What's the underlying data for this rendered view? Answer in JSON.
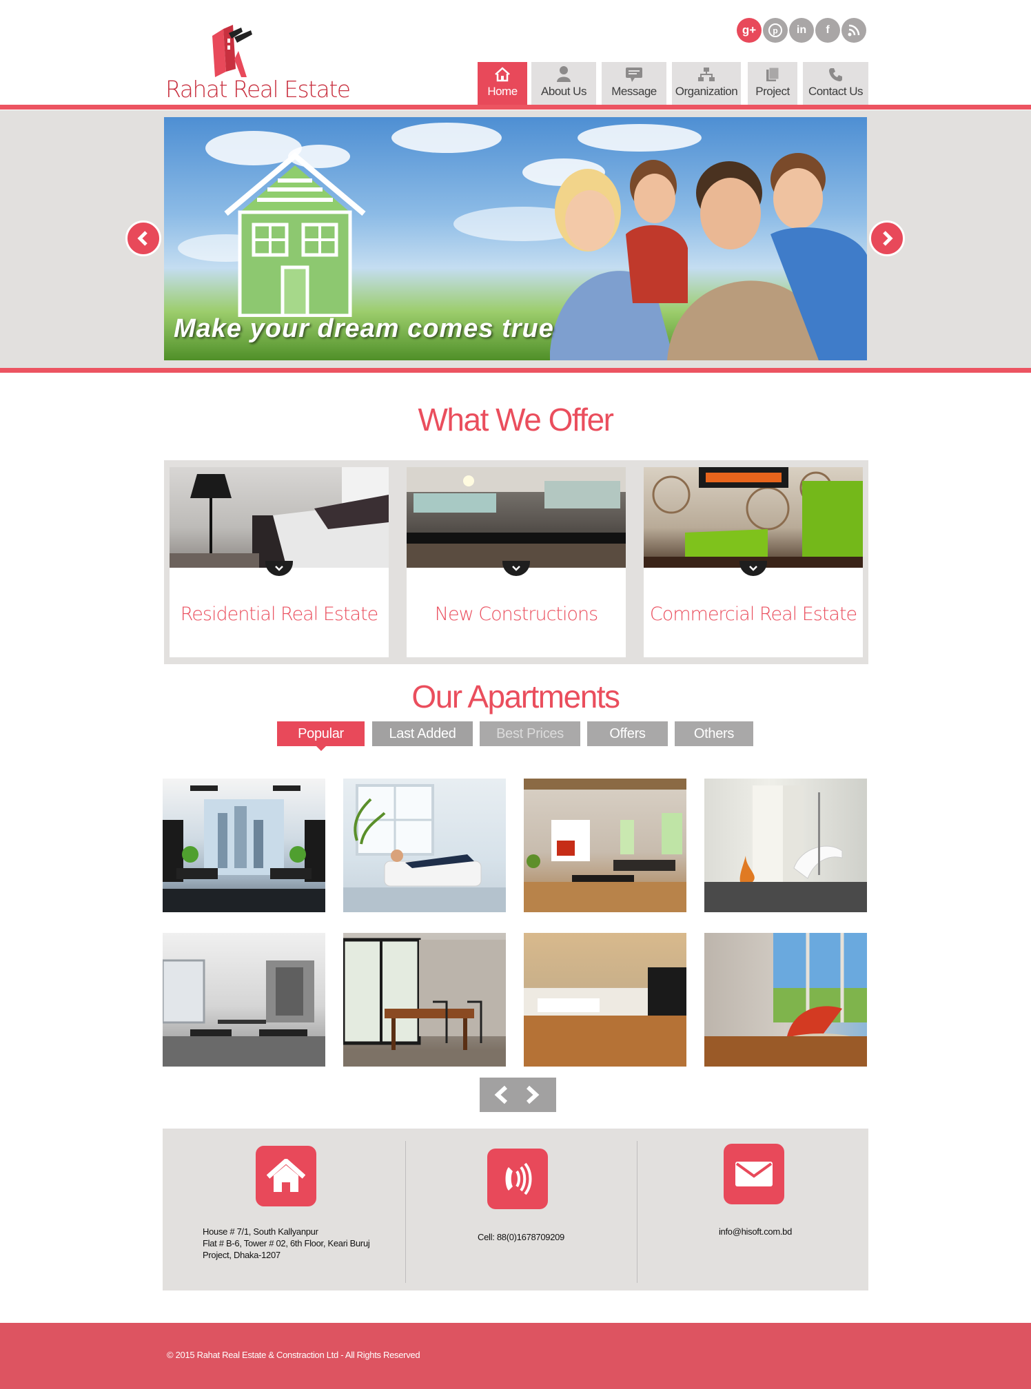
{
  "brand": {
    "name": "Rahat Real Estate",
    "accent": "#e8495a",
    "nav_gray": "#e2e0e0"
  },
  "social": [
    {
      "icon": "google-plus-icon",
      "glyph": "g+"
    },
    {
      "icon": "pinterest-icon",
      "glyph": "P"
    },
    {
      "icon": "linkedin-icon",
      "glyph": "in"
    },
    {
      "icon": "facebook-icon",
      "glyph": "f"
    },
    {
      "icon": "rss-icon",
      "glyph": "rss"
    }
  ],
  "nav": [
    {
      "label": "Home",
      "icon": "home-icon",
      "active": true
    },
    {
      "label": "About Us",
      "icon": "user-icon",
      "active": false
    },
    {
      "label": "Message",
      "icon": "message-icon",
      "active": false
    },
    {
      "label": "Organization",
      "icon": "organization-icon",
      "active": false
    },
    {
      "label": "Project",
      "icon": "project-icon",
      "active": false
    },
    {
      "label": "Contact Us",
      "icon": "phone-icon",
      "active": false
    }
  ],
  "slider": {
    "caption": "Make your dream comes true"
  },
  "offer": {
    "title": "What We Offer",
    "cards": [
      {
        "label": "Residential Real Estate"
      },
      {
        "label": "New Constructions"
      },
      {
        "label": "Commercial Real Estate"
      }
    ]
  },
  "apartments": {
    "title": "Our Apartments",
    "tabs": [
      "Popular",
      "Last Added",
      "Best Prices",
      "Offers",
      "Others"
    ],
    "active_tab": "Popular"
  },
  "contact": {
    "address": [
      "House # 7/1, South Kallyanpur",
      "Flat # B-6, Tower # 02, 6th Floor, Keari Buruj",
      "Project, Dhaka-1207"
    ],
    "phone": "Cell: 88(0)1678709209",
    "email": "info@hisoft.com.bd"
  },
  "footer": {
    "copyright": "© 2015 Rahat Real Estate & Constraction Ltd - All Rights Reserved"
  }
}
